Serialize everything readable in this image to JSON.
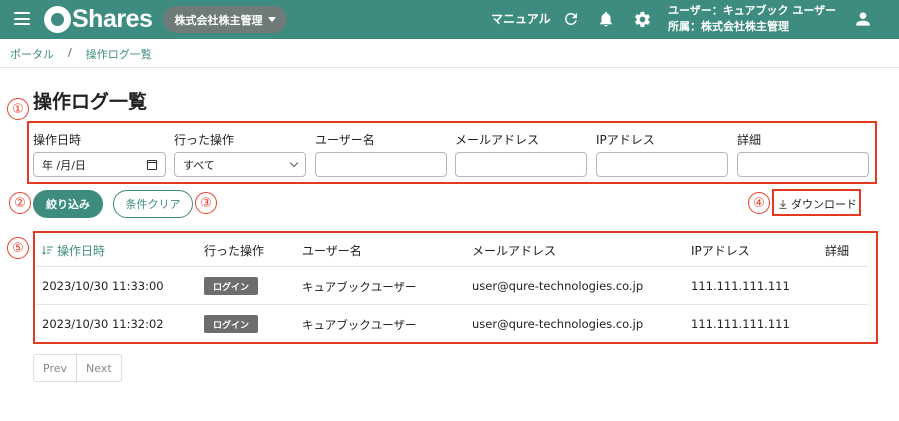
{
  "header": {
    "app_name": "Shares",
    "org_selector": "株式会社株主管理",
    "manual_label": "マニュアル",
    "user_line": "ユーザー：キュアブック ユーザー",
    "org_line": "所属：株式会社株主管理"
  },
  "breadcrumb": {
    "items": [
      "ポータル",
      "操作ログ一覧"
    ],
    "separator": "/"
  },
  "page": {
    "title": "操作ログ一覧"
  },
  "annotations": [
    "①",
    "②",
    "③",
    "④",
    "⑤"
  ],
  "filters": {
    "date_label": "操作日時",
    "date_value": "年 /月/日",
    "action_label": "行った操作",
    "action_value": "すべて",
    "user_label": "ユーザー名",
    "user_value": "",
    "email_label": "メールアドレス",
    "email_value": "",
    "ip_label": "IPアドレス",
    "ip_value": "",
    "detail_label": "詳細",
    "detail_value": ""
  },
  "actions": {
    "filter_button": "絞り込み",
    "clear_button": "条件クリア",
    "download_button": "ダウンロード"
  },
  "table": {
    "headers": [
      "操作日時",
      "行った操作",
      "ユーザー名",
      "メールアドレス",
      "IPアドレス",
      "詳細"
    ],
    "rows": [
      {
        "datetime": "2023/10/30 11:33:00",
        "action": "ログイン",
        "user": "キュアブックユーザー",
        "email": "user@qure-technologies.co.jp",
        "ip": "111.111.111.111",
        "detail": ""
      },
      {
        "datetime": "2023/10/30 11:32:02",
        "action": "ログイン",
        "user": "キュアブックユーザー",
        "email": "user@qure-technologies.co.jp",
        "ip": "111.111.111.111",
        "detail": ""
      }
    ]
  },
  "pagination": {
    "prev": "Prev",
    "next": "Next"
  },
  "colors": {
    "brand": "#3d8c7f",
    "annotation": "#e2391f",
    "badge": "#6d6d6d"
  }
}
